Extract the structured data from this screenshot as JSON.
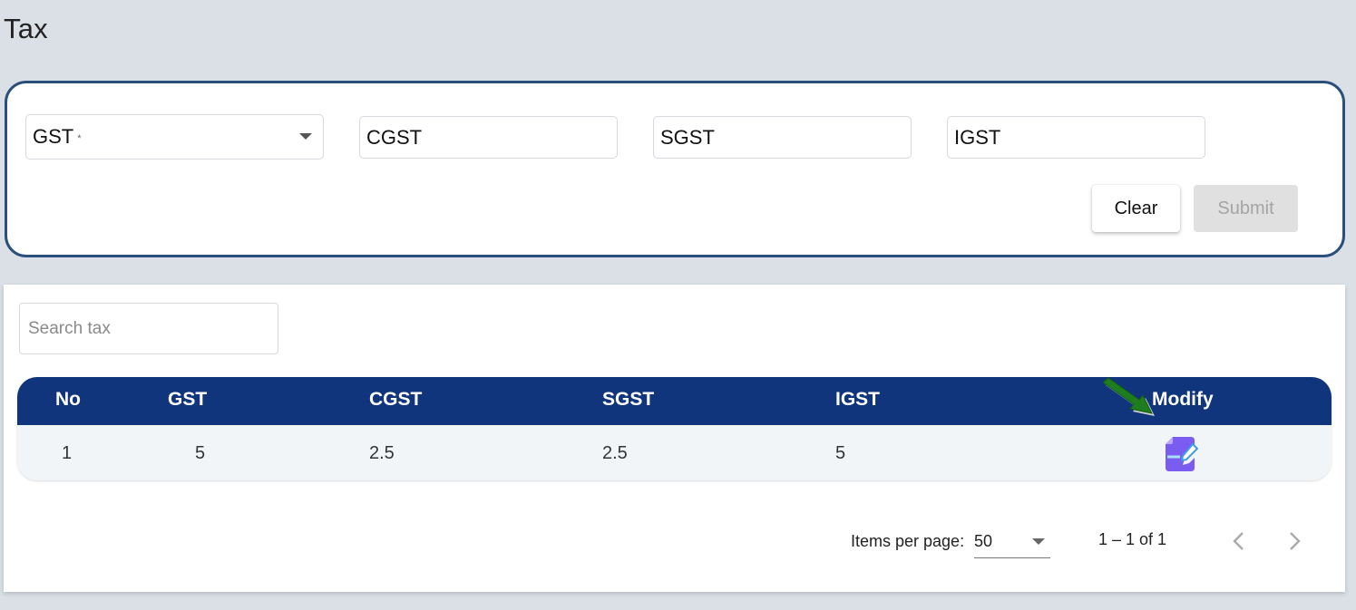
{
  "page": {
    "title": "Tax"
  },
  "form": {
    "gst": {
      "label": "GST",
      "required_mark": "*"
    },
    "cgst": {
      "placeholder": "CGST"
    },
    "sgst": {
      "placeholder": "SGST"
    },
    "igst": {
      "placeholder": "IGST"
    },
    "clear_label": "Clear",
    "submit_label": "Submit"
  },
  "list": {
    "search_placeholder": "Search tax",
    "columns": [
      "No",
      "GST",
      "CGST",
      "SGST",
      "IGST",
      "Modify"
    ],
    "rows": [
      {
        "no": "1",
        "gst": "5",
        "cgst": "2.5",
        "sgst": "2.5",
        "igst": "5"
      }
    ],
    "modify_icon": "edit-document-icon",
    "annotation_icon": "green-arrow-icon"
  },
  "paginator": {
    "items_per_page_label": "Items per page:",
    "items_per_page_value": "50",
    "range_label": "1 – 1 of 1"
  },
  "colors": {
    "header_bg": "#10357d",
    "form_border": "#2b4f7c",
    "edit_icon": "#7b5cf0",
    "annotation_arrow": "#1e7d1e"
  }
}
